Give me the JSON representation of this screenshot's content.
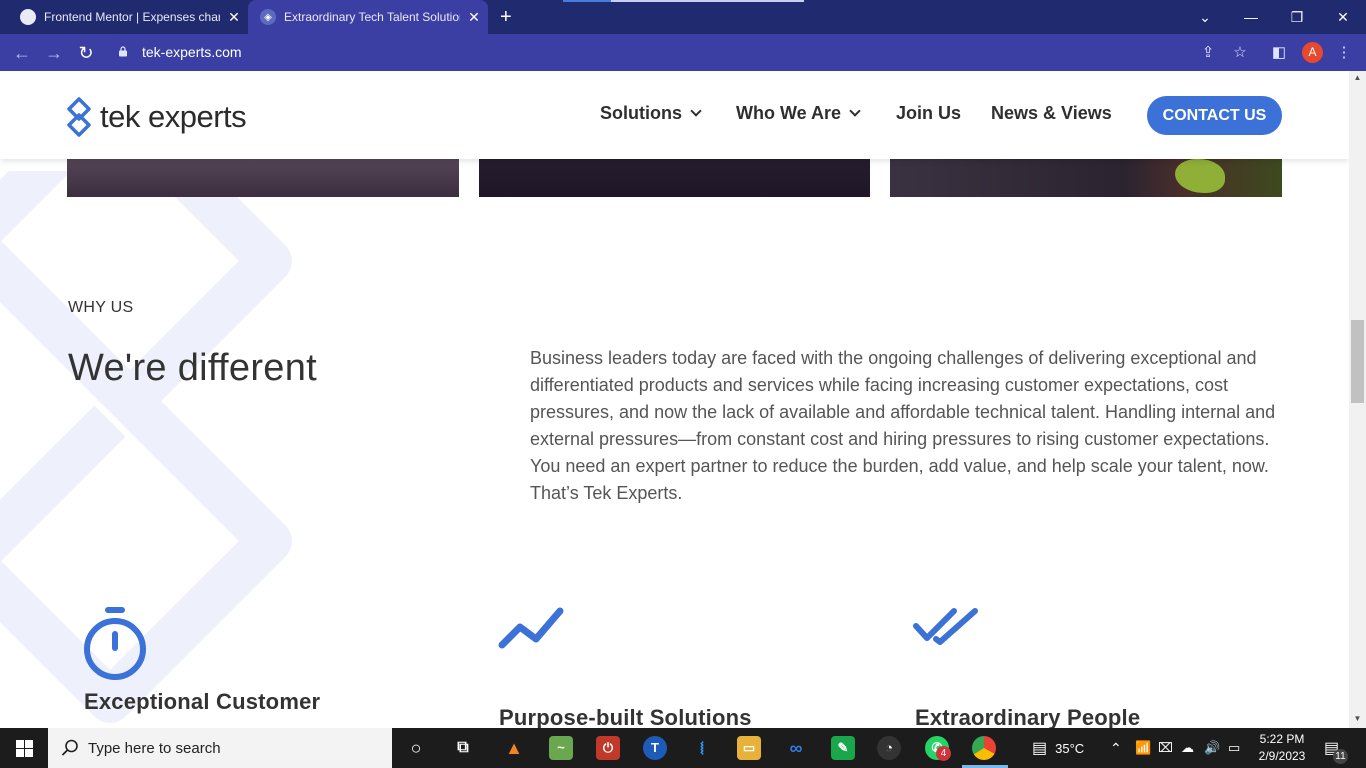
{
  "browser": {
    "tabs": [
      {
        "title": "Frontend Mentor | Expenses char",
        "active": false
      },
      {
        "title": "Extraordinary Tech Talent Solution",
        "active": true
      }
    ],
    "url": "tek-experts.com",
    "profile_initial": "A"
  },
  "site": {
    "brand": "tek experts",
    "nav": {
      "items": [
        "Solutions",
        "Who We Are",
        "Join Us",
        "News & Views"
      ],
      "contact_label": "CONTACT US"
    },
    "why_us": {
      "eyebrow": "WHY US",
      "heading": "We're different",
      "body": "Business leaders today are faced with the ongoing challenges of delivering exceptional and differentiated products and services while facing increasing customer expectations, cost pressures, and now the lack of available and affordable technical talent. Handling internal and external pressures—from constant cost and hiring pressures to rising customer expectations. You need an expert partner to reduce the burden, add value, and help scale your talent, now. That’s Tek Experts."
    },
    "features": [
      {
        "title": "Exceptional Customer",
        "icon": "stopwatch-icon"
      },
      {
        "title": "Purpose-built Solutions",
        "icon": "trend-up-icon"
      },
      {
        "title": "Extraordinary People",
        "icon": "double-check-icon"
      }
    ],
    "accent_color": "#3c71d8"
  },
  "taskbar": {
    "search_placeholder": "Type here to search",
    "weather": "35°C",
    "time": "5:22 PM",
    "date": "2/9/2023",
    "whatsapp_badge": "4",
    "notification_count": "11"
  }
}
